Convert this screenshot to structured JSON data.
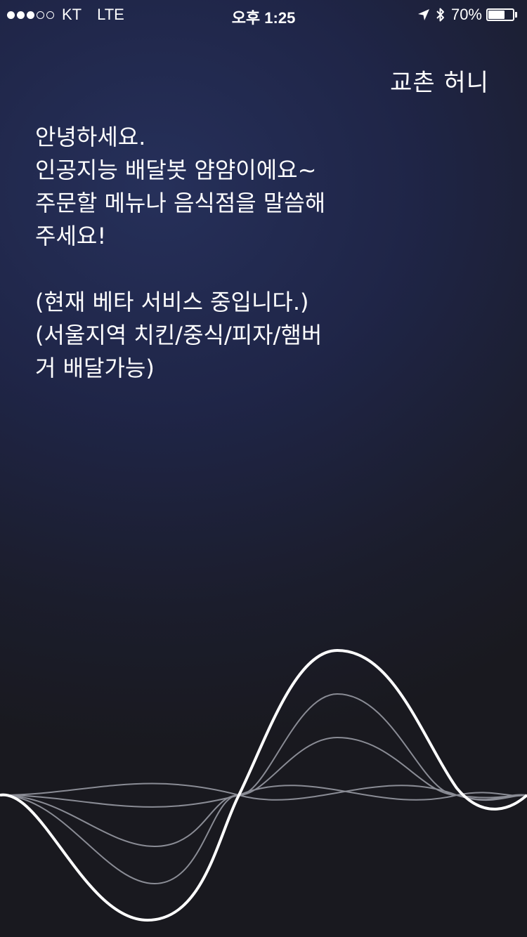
{
  "status_bar": {
    "carrier": "KT",
    "network": "LTE",
    "time": "오후 1:25",
    "battery_percent": "70%",
    "battery_level": 0.7,
    "signal_bars": 3,
    "signal_total": 5,
    "icons": [
      "location-arrow-icon",
      "bluetooth-icon",
      "battery-icon"
    ]
  },
  "conversation": {
    "user_query": "교촌 허니",
    "bot_lines": [
      "안녕하세요.",
      "인공지능 배달봇 얌얌이에요~",
      "주문할 메뉴나 음식점을 말씀해",
      "주세요!"
    ],
    "notice_lines": [
      "(현재 베타 서비스 중입니다.)",
      "(서울지역 치킨/중식/피자/햄버",
      "거 배달가능)"
    ]
  },
  "voice_wave": {
    "icon": "voice-waveform-icon",
    "main_color": "#ffffff",
    "echo_color": "#8a8c95"
  }
}
